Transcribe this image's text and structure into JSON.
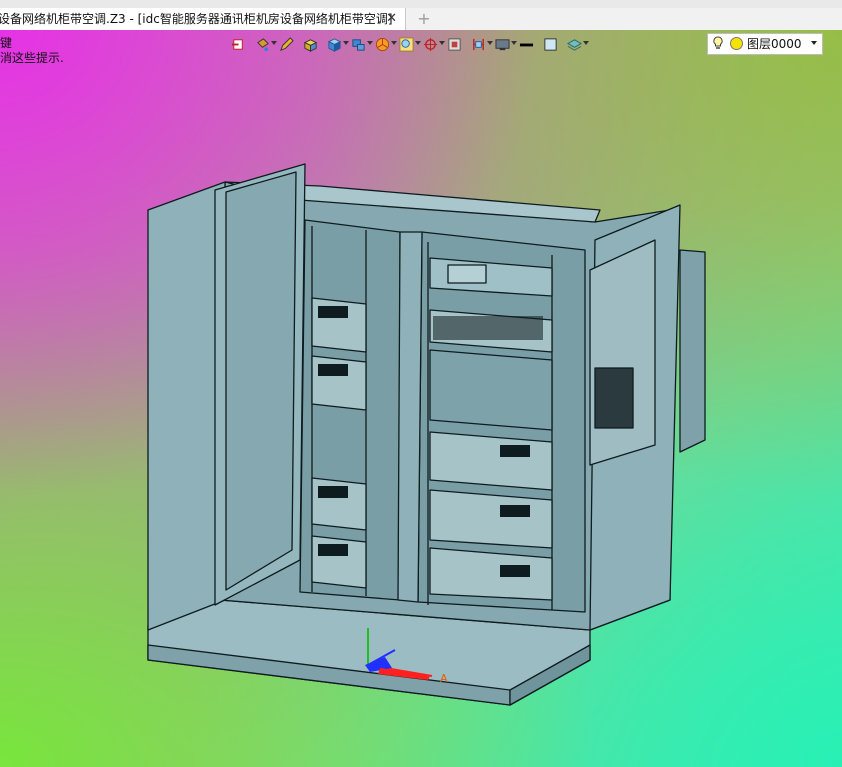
{
  "tabbar": {
    "active_tab_label": "设备网络机柜带空调.Z3 - [idc智能服务器通讯柜机房设备网络机柜带空调]",
    "close_glyph": "✕",
    "new_tab_glyph": "+"
  },
  "prompt": {
    "line1": "键",
    "line2": "消这些提示."
  },
  "toolbar": {
    "icons": [
      "exit-icon",
      "paint-bucket-icon",
      "pencil-icon",
      "box-yellow-icon",
      "cube-blue-icon",
      "cube-stack-icon",
      "color-wheel-icon",
      "zoom-view-icon",
      "crosshair-icon",
      "grid-frame-icon",
      "dimension-icon",
      "display-mode-icon",
      "line-style-icon",
      "fill-square-icon",
      "layer-stack-icon"
    ],
    "layer": {
      "label": "图层0000",
      "bulb_icon": "bulb-icon",
      "color": "#f5e200"
    }
  },
  "colors": {
    "cabinet": "#8fb2ba",
    "cabinet_dark": "#6f949c",
    "cabinet_light": "#a9c6cc",
    "edge": "#0e1b1f",
    "axis_x": "#ff2020",
    "axis_y": "#20c020",
    "axis_z": "#2030ff"
  }
}
